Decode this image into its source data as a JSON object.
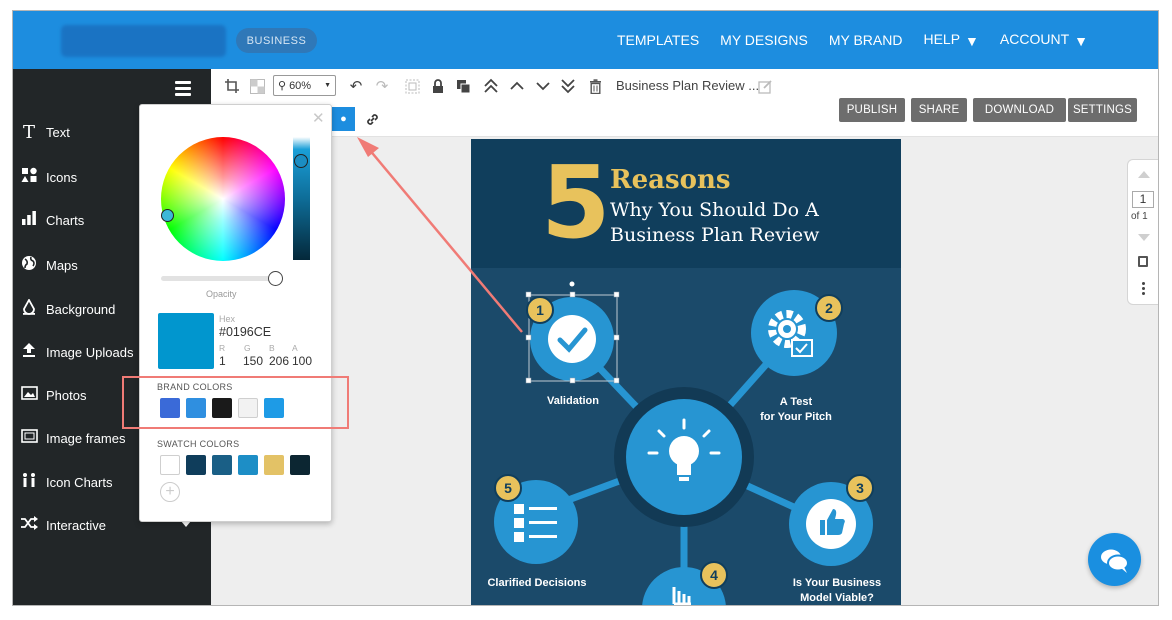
{
  "nav": {
    "business_badge": "BUSINESS",
    "links": [
      "TEMPLATES",
      "MY DESIGNS",
      "MY BRAND",
      "HELP",
      "ACCOUNT"
    ]
  },
  "sidebar": {
    "items": [
      {
        "label": "Text",
        "icon": "text-icon"
      },
      {
        "label": "Icons",
        "icon": "icons-icon"
      },
      {
        "label": "Charts",
        "icon": "bar-chart-icon"
      },
      {
        "label": "Maps",
        "icon": "globe-icon"
      },
      {
        "label": "Background",
        "icon": "paint-bucket-icon"
      },
      {
        "label": "Image Uploads",
        "icon": "upload-icon"
      },
      {
        "label": "Photos",
        "icon": "photo-icon"
      },
      {
        "label": "Image frames",
        "icon": "image-frame-icon"
      },
      {
        "label": "Icon Charts",
        "icon": "icon-chart-icon"
      },
      {
        "label": "Interactive",
        "icon": "shuffle-icon"
      }
    ]
  },
  "toolbar": {
    "zoom": "60%",
    "doc_title": "Business Plan Review ...",
    "buttons": [
      "PUBLISH",
      "SHARE",
      "DOWNLOAD",
      "SETTINGS"
    ]
  },
  "pager": {
    "page": "1",
    "of": "of 1"
  },
  "picker": {
    "opacity_label": "Opacity",
    "opacity_value": 1.0,
    "hex_label": "Hex",
    "hex": "#0196CE",
    "rgba_labels": [
      "R",
      "G",
      "B",
      "A"
    ],
    "rgba_values": [
      "1",
      "150",
      "206",
      "100"
    ],
    "brand_label": "BRAND COLORS",
    "brand_colors": [
      "#3a6ad8",
      "#2f8fe0",
      "#1a1a1a",
      "#f2f2f2",
      "#1e9be6"
    ],
    "swatch_label": "SWATCH COLORS",
    "swatch_colors": [
      "#ffffff",
      "#0f3d5b",
      "#1a5f86",
      "#1d8ec6",
      "#e3c266",
      "#0c2632"
    ],
    "selected_color": "#0196CE"
  },
  "infographic": {
    "number": "5",
    "title": "Reasons",
    "subtitle_1": "Why You Should Do A",
    "subtitle_2": "Business Plan Review",
    "nodes": [
      {
        "num": "1",
        "label": "Validation"
      },
      {
        "num": "2",
        "label": "A Test\nfor Your Pitch"
      },
      {
        "num": "3",
        "label": "Is Your Business\nModel Viable?"
      },
      {
        "num": "4",
        "label": ""
      },
      {
        "num": "5",
        "label": "Clarified Decisions"
      }
    ],
    "colors": {
      "dark": "#103e5c",
      "mid": "#1b4a6a",
      "gold": "#e8c25c",
      "circle": "#2795d2"
    }
  },
  "annotation_color": "#f07b76"
}
